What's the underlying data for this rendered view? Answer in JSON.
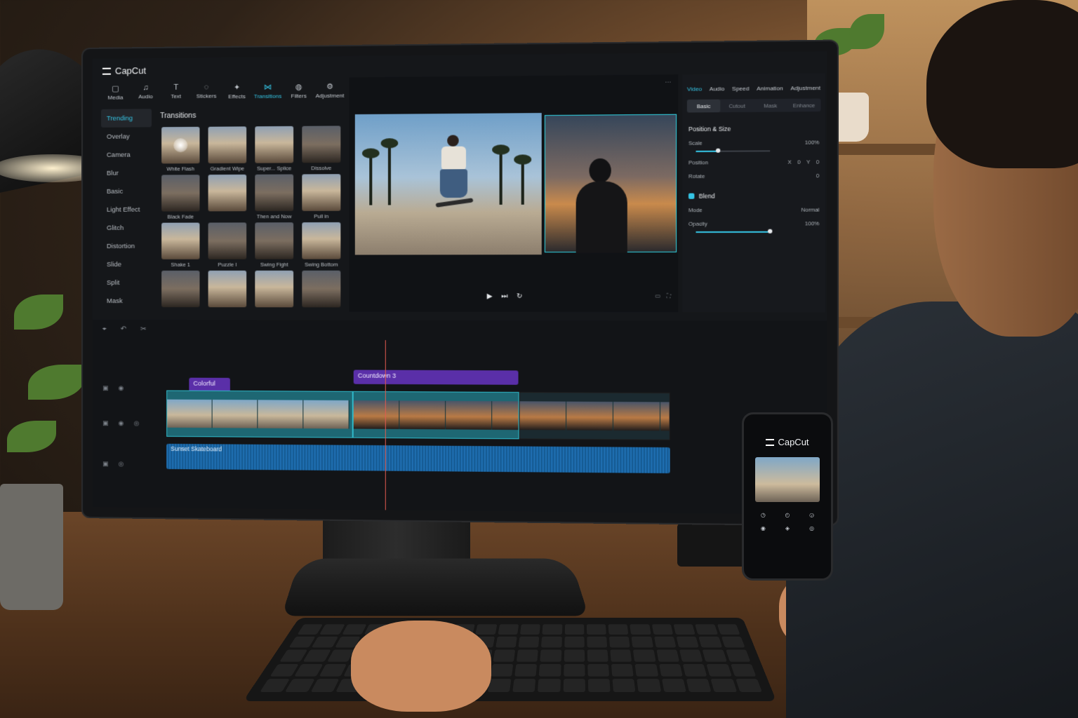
{
  "app": {
    "name": "CapCut"
  },
  "toolbar": [
    {
      "label": "Media",
      "icon": "media-icon",
      "glyph": "▢",
      "active": false
    },
    {
      "label": "Audio",
      "icon": "audio-icon",
      "glyph": "♫",
      "active": false
    },
    {
      "label": "Text",
      "icon": "text-icon",
      "glyph": "T",
      "active": false
    },
    {
      "label": "Stickers",
      "icon": "stickers-icon",
      "glyph": "◌",
      "active": false
    },
    {
      "label": "Effects",
      "icon": "effects-icon",
      "glyph": "✦",
      "active": false
    },
    {
      "label": "Transitions",
      "icon": "transitions-icon",
      "glyph": "⋈",
      "active": true
    },
    {
      "label": "Filters",
      "icon": "filters-icon",
      "glyph": "◍",
      "active": false
    },
    {
      "label": "Adjustment",
      "icon": "adjustment-icon",
      "glyph": "⚙",
      "active": false
    }
  ],
  "categories": [
    {
      "label": "Trending",
      "active": true
    },
    {
      "label": "Overlay"
    },
    {
      "label": "Camera"
    },
    {
      "label": "Blur"
    },
    {
      "label": "Basic"
    },
    {
      "label": "Light Effect"
    },
    {
      "label": "Glitch"
    },
    {
      "label": "Distortion"
    },
    {
      "label": "Slide"
    },
    {
      "label": "Split"
    },
    {
      "label": "Mask"
    }
  ],
  "transitions": {
    "title": "Transitions",
    "items": [
      {
        "label": "White Flash",
        "style": "glow"
      },
      {
        "label": "Gradient Wipe",
        "style": "light"
      },
      {
        "label": "Super... Splice",
        "style": "light"
      },
      {
        "label": "Dissolve",
        "style": "dark"
      },
      {
        "label": "Black Fade",
        "style": "dark"
      },
      {
        "label": "",
        "style": "light"
      },
      {
        "label": "Then and Now",
        "style": "dark"
      },
      {
        "label": "Pull in",
        "style": "light"
      },
      {
        "label": "Shake 1",
        "style": "light"
      },
      {
        "label": "Puzzle I",
        "style": "dark"
      },
      {
        "label": "Swing Fight",
        "style": "dark"
      },
      {
        "label": "Swing Bottom",
        "style": "light"
      },
      {
        "label": "",
        "style": "dark"
      },
      {
        "label": "",
        "style": "light"
      },
      {
        "label": "",
        "style": "light"
      },
      {
        "label": "",
        "style": "dark"
      }
    ]
  },
  "inspector": {
    "tabs": [
      {
        "label": "Video",
        "active": true
      },
      {
        "label": "Audio"
      },
      {
        "label": "Speed"
      },
      {
        "label": "Animation"
      },
      {
        "label": "Adjustment"
      }
    ],
    "subtabs": [
      {
        "label": "Basic",
        "active": true
      },
      {
        "label": "Cutout"
      },
      {
        "label": "Mask"
      },
      {
        "label": "Enhance"
      }
    ],
    "position_size": {
      "title": "Position & Size",
      "scale_label": "Scale",
      "scale_value": "100%",
      "scale_fraction": 0.3,
      "position_label": "Position",
      "x_label": "X",
      "x_value": "0",
      "y_label": "Y",
      "y_value": "0",
      "rotate_label": "Rotate",
      "rotate_value": "0"
    },
    "blend": {
      "title": "Blend",
      "mode_label": "Mode",
      "mode_value": "Normal",
      "opacity_label": "Opacity",
      "opacity_value": "100%",
      "opacity_fraction": 1.0
    }
  },
  "timeline": {
    "text_clips": [
      {
        "label": "Colorful"
      },
      {
        "label": "Countdown 3"
      }
    ],
    "audio_clip": {
      "label": "Sunset Skateboard"
    }
  },
  "phone": {
    "app_name": "CapCut"
  },
  "colors": {
    "accent": "#35c4e4",
    "text_clip": "#5a2fa8",
    "audio": "#1f6fb2",
    "playhead": "#e25a4e"
  }
}
